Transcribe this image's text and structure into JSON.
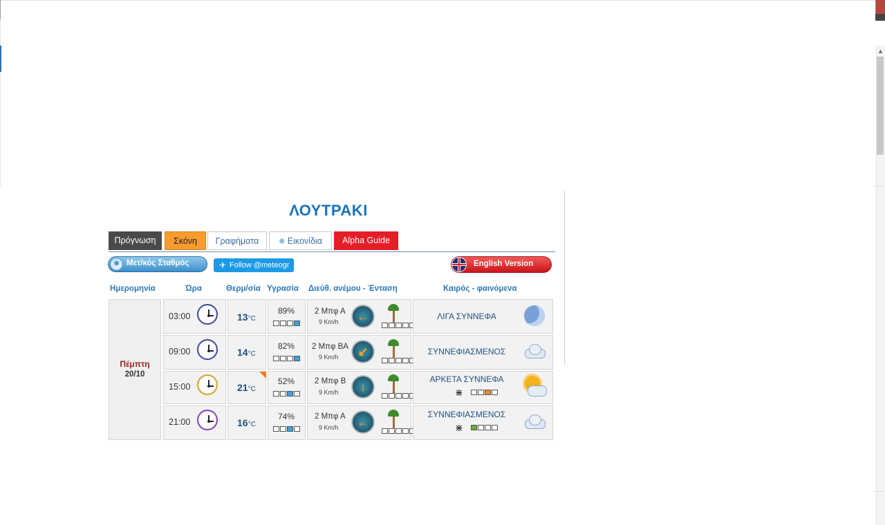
{
  "page": {
    "title": "ΛΟΥΤΡΑΚΙ",
    "tabs": [
      "Πρόγνωση",
      "Σκόνη",
      "Γραφήματα",
      "Εικονίδια",
      "Alpha Guide"
    ],
    "tab_images_icon": "❄",
    "station_button": "Μετ/κός Σταθμός",
    "twitter_button": "Follow @meteogr",
    "english_button": "English Version"
  },
  "table": {
    "headers": [
      "Ημερομηνία",
      "Ώρα",
      "Θερμ/σία",
      "Υγρασία",
      "Διεύθ. ανέμου - Ένταση",
      "Καιρός - φαινόμενα"
    ],
    "day": "Πέμπτη",
    "date": "20/10",
    "temp_unit": "°C",
    "rows": [
      {
        "time": "03:00",
        "temp": "13",
        "humidity": "89%",
        "hum_level": 4,
        "wind": "2 Μπφ Α",
        "wind_speed": "9 Km/h",
        "wind_icon": "arrow-left-icon",
        "wind_level": 1,
        "condition": "ΛΙΓΑ ΣΥΝΝΕΦΑ",
        "cond_icon": "moon-icon"
      },
      {
        "time": "09:00",
        "temp": "14",
        "humidity": "82%",
        "hum_level": 4,
        "wind": "2 Μπφ ΒΑ",
        "wind_speed": "9 Km/h",
        "wind_icon": "arrow-down-left-icon",
        "wind_level": 1,
        "condition": "ΣΥΝΝΕΦΙΑΣΜΕΝΟΣ",
        "cond_icon": "cloud-icon"
      },
      {
        "time": "15:00",
        "temp": "21",
        "humidity": "52%",
        "hum_level": 3,
        "wind": "2 Μπφ Β",
        "wind_speed": "9 Km/h",
        "wind_icon": "arrow-down-icon",
        "wind_level": 1,
        "condition": "ΑΡΚΕΤΑ ΣΥΝΝΕΦΑ",
        "cond_icon": "sun-cloud-icon",
        "mosquito_level": 3
      },
      {
        "time": "21:00",
        "temp": "16",
        "humidity": "74%",
        "hum_level": 3,
        "wind": "2 Μπφ Α",
        "wind_speed": "9 Km/h",
        "wind_icon": "arrow-left-icon",
        "wind_level": 1,
        "condition": "ΣΥΝΝΕΦΙΑΣΜΕΝΟΣ",
        "cond_icon": "cloud-icon",
        "mosquito_level": 1
      }
    ]
  },
  "colors": {
    "accent": "#1a72bb",
    "dust_tab": "#f79b2e",
    "alpha_tab": "#e41e26",
    "day_label": "#9b1d1d"
  }
}
